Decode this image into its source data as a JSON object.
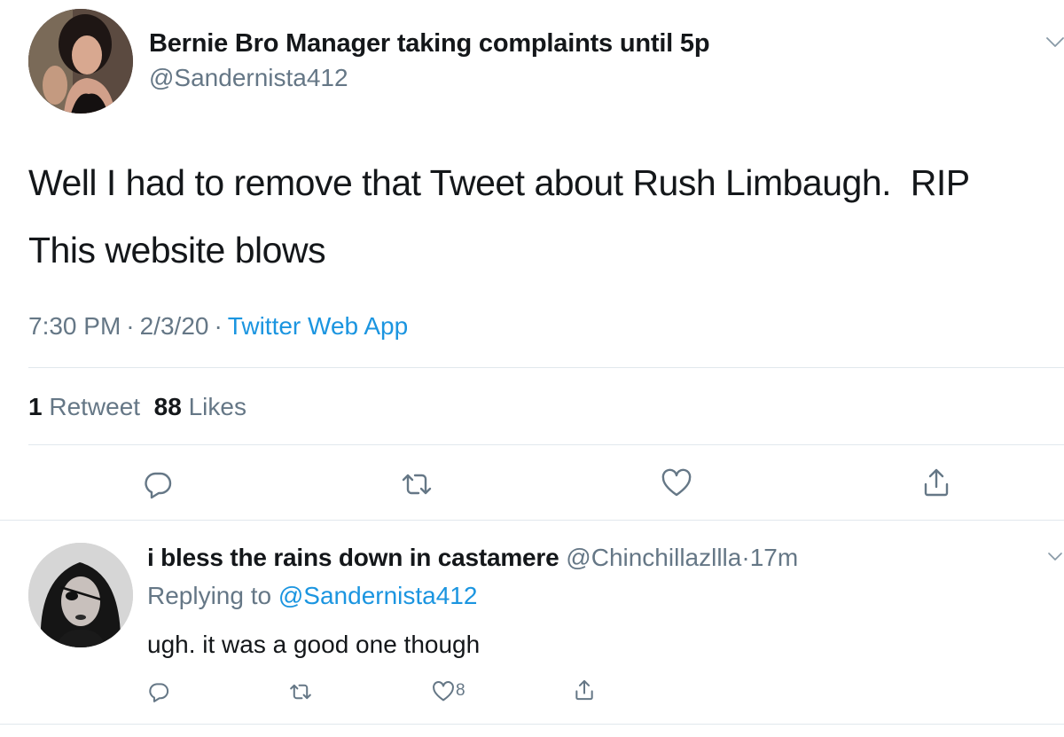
{
  "tweet": {
    "display_name": "Bernie Bro Manager taking complaints until 5p",
    "handle": "@Sandernista412",
    "text_line1": "Well I had to remove that Tweet about Rush Limbaugh.  RIP",
    "text_line2": "This website blows",
    "time": "7:30 PM",
    "date": "2/3/20",
    "source": "Twitter Web App",
    "separator": "·",
    "retweet_count": "1",
    "retweet_label": "Retweet",
    "like_count": "88",
    "like_label": "Likes",
    "icons": [
      "chevron-down-icon",
      "reply-icon",
      "retweet-icon",
      "heart-icon",
      "share-icon"
    ]
  },
  "reply": {
    "display_name": "i bless the rains down in castamere",
    "handle": "@Chinchillazllla",
    "separator": "·",
    "time": "17m",
    "replying_prefix": "Replying to",
    "replying_to": "@Sandernista412",
    "text": "ugh. it was a good one though",
    "like_count": "8",
    "icons": [
      "chevron-down-icon",
      "reply-icon",
      "retweet-icon",
      "heart-icon",
      "share-icon"
    ]
  },
  "colors": {
    "text": "#14171a",
    "secondary": "#657786",
    "link": "#1b95e0",
    "divider": "#e1e8ed"
  }
}
